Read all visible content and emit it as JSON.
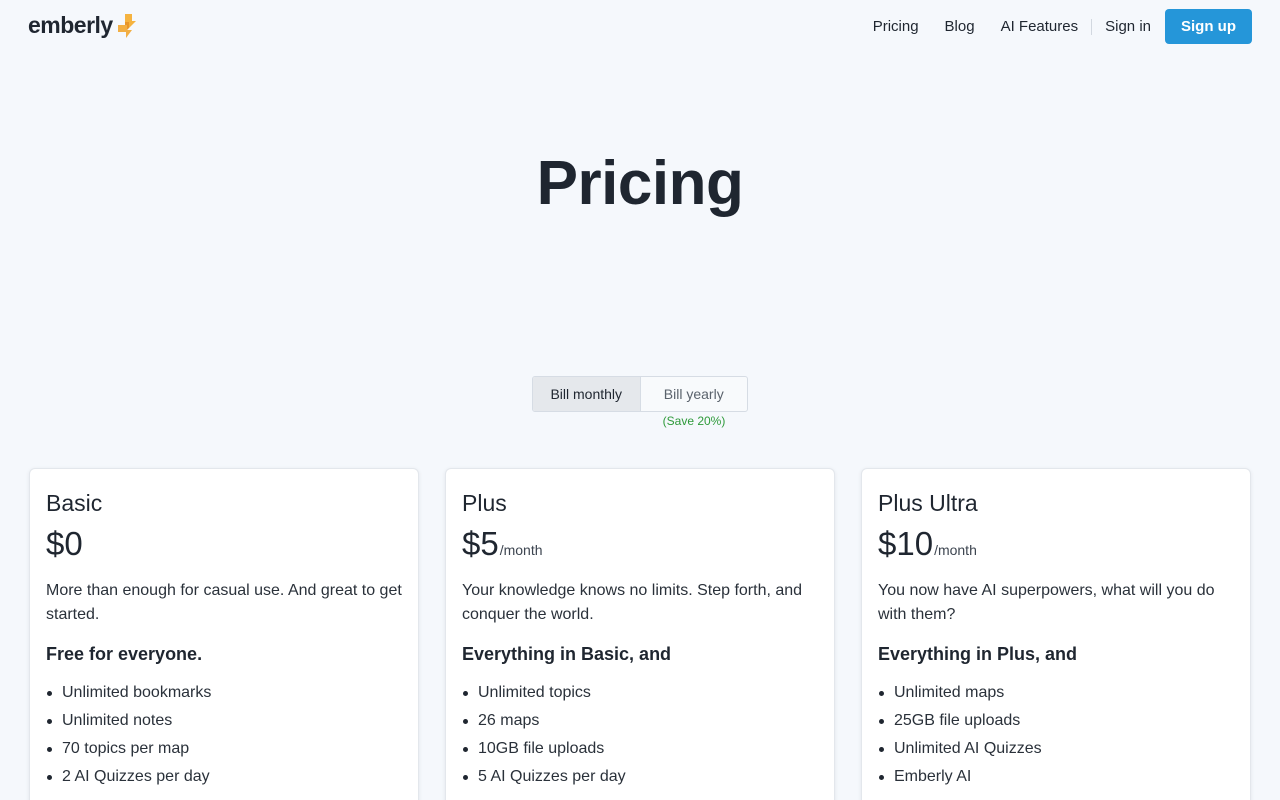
{
  "header": {
    "logo_text": "emberly",
    "nav": {
      "pricing": "Pricing",
      "blog": "Blog",
      "ai_features": "AI Features",
      "sign_in": "Sign in",
      "sign_up": "Sign up"
    }
  },
  "page_title": "Pricing",
  "billing": {
    "monthly_label": "Bill monthly",
    "yearly_label": "Bill yearly",
    "save_note": "(Save 20%)",
    "selected": "monthly"
  },
  "plans": [
    {
      "name": "Basic",
      "price": "$0",
      "period": "",
      "description": "More than enough for casual use. And great to get started.",
      "features_heading": "Free for everyone.",
      "features": [
        "Unlimited bookmarks",
        "Unlimited notes",
        "70 topics per map",
        "2 AI Quizzes per day"
      ]
    },
    {
      "name": "Plus",
      "price": "$5",
      "period": "/month",
      "description": "Your knowledge knows no limits. Step forth, and conquer the world.",
      "features_heading": "Everything in Basic, and",
      "features": [
        "Unlimited topics",
        "26 maps",
        "10GB file uploads",
        "5 AI Quizzes per day"
      ]
    },
    {
      "name": "Plus Ultra",
      "price": "$10",
      "period": "/month",
      "description": "You now have AI superpowers, what will you do with them?",
      "features_heading": "Everything in Plus, and",
      "features": [
        "Unlimited maps",
        "25GB file uploads",
        "Unlimited AI Quizzes",
        "Emberly AI"
      ]
    }
  ],
  "colors": {
    "accent": "#2596d9",
    "logo_mark": "#f5b340",
    "save_green": "#2e9a3a",
    "background": "#f5f8fc"
  },
  "icons": {
    "logo_mark": "emberly-flame-icon"
  }
}
